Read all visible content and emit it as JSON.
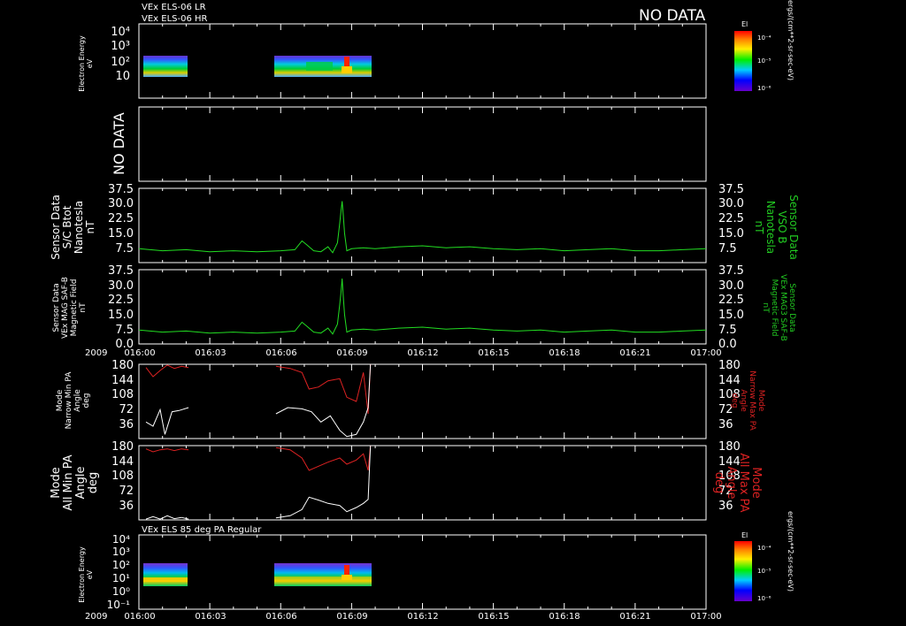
{
  "header": {
    "line1": "VEx ELS-06 LR",
    "line2": "VEx ELS-06 HR",
    "no_data_banner": "NO DATA"
  },
  "time_axis": {
    "year": "2009",
    "ticks": [
      "016:00",
      "016:03",
      "016:06",
      "016:09",
      "016:12",
      "016:15",
      "016:18",
      "016:21",
      "017:00"
    ]
  },
  "colors": {
    "background": "#000000",
    "axes": "#ffffff",
    "green_trace": "#22dd22",
    "green_label": "#22cc22",
    "red_trace": "#dd2222",
    "white_trace": "#ffffff"
  },
  "chart_data": [
    {
      "type": "heatmap",
      "panel": "electron-spectrogram-top",
      "ylabel": [
        "Electron Energy",
        "eV"
      ],
      "yscale": "log",
      "yticks": [
        "10",
        "10²",
        "10³",
        "10⁴"
      ],
      "colorbar": {
        "title": "El",
        "scale": "log",
        "ticks": [
          "10⁻⁴",
          "10⁻⁵",
          "10⁻⁶"
        ],
        "unit": "ergs/(cm**2-sr-sec-eV)"
      },
      "coverage_minutes": [
        [
          0,
          2.0
        ],
        [
          5.8,
          9.8
        ]
      ],
      "spike_minute": 8.6
    },
    {
      "type": "line",
      "panel": "no-data-panel",
      "no_data_label": "NO DATA"
    },
    {
      "type": "line",
      "panel": "bmag-sc",
      "ylabel": [
        "Sensor Data",
        "S/C Btot",
        "Nanotesla",
        "nT"
      ],
      "ylabel_right": [
        "Sensor Data",
        "VSO B",
        "Nanotesla",
        "nT"
      ],
      "ylim": [
        0,
        37.5
      ],
      "yticks": [
        "7.5",
        "15.0",
        "22.5",
        "30.0",
        "37.5"
      ],
      "series": [
        {
          "x": [
            0,
            1,
            2,
            3,
            4,
            5,
            6,
            6.6,
            6.9,
            7.1,
            7.4,
            7.7,
            8.0,
            8.2,
            8.4,
            8.5,
            8.55,
            8.6,
            8.65,
            8.7,
            8.8,
            9.0,
            9.5,
            10,
            11,
            12,
            13,
            14,
            15,
            16,
            17,
            18,
            19,
            20,
            21,
            22,
            23,
            24
          ],
          "y": [
            7,
            6,
            6.5,
            5.5,
            6,
            5.5,
            6,
            6.5,
            11,
            9,
            6,
            5.5,
            8,
            5,
            10,
            20,
            26,
            31,
            24,
            15,
            6,
            7,
            7.5,
            7,
            8,
            8.5,
            7.5,
            8,
            7,
            6.5,
            7,
            6,
            6.5,
            7,
            6,
            6,
            6.5,
            7
          ]
        }
      ]
    },
    {
      "type": "line",
      "panel": "bmag-mag",
      "ylabel": [
        "Sensor Data",
        "VEx MAG SAF-B",
        "Magnetic Field",
        "nT"
      ],
      "ylabel_right": [
        "Sensor Data",
        "VEx MAG3 SAF-B",
        "Magnetic Field",
        "nT"
      ],
      "ylim": [
        0,
        37.5
      ],
      "yticks": [
        "0.0",
        "7.5",
        "15.0",
        "22.5",
        "30.0",
        "37.5"
      ],
      "series": [
        {
          "x": [
            0,
            1,
            2,
            3,
            4,
            5,
            6,
            6.6,
            6.9,
            7.1,
            7.4,
            7.7,
            8.0,
            8.2,
            8.4,
            8.5,
            8.55,
            8.6,
            8.65,
            8.7,
            8.8,
            9.0,
            9.5,
            10,
            11,
            12,
            13,
            14,
            15,
            16,
            17,
            18,
            19,
            20,
            21,
            22,
            23,
            24
          ],
          "y": [
            7,
            6,
            6.5,
            5.5,
            6,
            5.5,
            6,
            6.5,
            11,
            9,
            6,
            5.5,
            8,
            5,
            10,
            20,
            26,
            33,
            24,
            15,
            6,
            7,
            7.5,
            7,
            8,
            8.5,
            7.5,
            8,
            7,
            6.5,
            7,
            6,
            6.5,
            7,
            6,
            6,
            6.5,
            7
          ]
        }
      ]
    },
    {
      "type": "line",
      "panel": "pitch-angle-narrow",
      "ylabel": [
        "Mode",
        "Narrow Min PA",
        "Angle",
        "deg"
      ],
      "ylabel_right": [
        "Mode",
        "Narrow Max PA",
        "Angle",
        "deg"
      ],
      "ylim": [
        0,
        180
      ],
      "yticks": [
        "36",
        "72",
        "108",
        "144",
        "180"
      ],
      "series": [
        {
          "color": "red",
          "segments": [
            {
              "x": [
                0.3,
                0.6,
                0.9,
                1.2,
                1.5,
                1.8,
                2.1
              ],
              "y": [
                172,
                150,
                165,
                178,
                170,
                175,
                172
              ]
            },
            {
              "x": [
                5.8,
                6.4,
                6.9,
                7.2,
                7.6,
                8.0,
                8.5,
                8.8,
                9.2,
                9.5,
                9.7,
                9.8
              ],
              "y": [
                175,
                170,
                160,
                120,
                125,
                140,
                145,
                100,
                90,
                160,
                60,
                180
              ]
            }
          ]
        },
        {
          "color": "white",
          "segments": [
            {
              "x": [
                0.3,
                0.6,
                0.9,
                1.1,
                1.4,
                1.7,
                2.1
              ],
              "y": [
                40,
                30,
                70,
                10,
                65,
                68,
                75
              ]
            },
            {
              "x": [
                5.8,
                6.3,
                6.9,
                7.3,
                7.7,
                8.1,
                8.5,
                8.8,
                9.2,
                9.5,
                9.7,
                9.8
              ],
              "y": [
                60,
                75,
                72,
                65,
                40,
                55,
                20,
                5,
                10,
                40,
                75,
                180
              ]
            }
          ]
        }
      ]
    },
    {
      "type": "line",
      "panel": "pitch-angle-all",
      "ylabel": [
        "Mode",
        "All Min PA",
        "Angle",
        "deg"
      ],
      "ylabel_right": [
        "Mode",
        "All Max PA",
        "Angle",
        "deg"
      ],
      "ylim": [
        0,
        180
      ],
      "yticks": [
        "36",
        "72",
        "108",
        "144",
        "180"
      ],
      "series": [
        {
          "color": "red",
          "segments": [
            {
              "x": [
                0.3,
                0.6,
                0.9,
                1.2,
                1.5,
                1.8,
                2.1
              ],
              "y": [
                172,
                165,
                170,
                172,
                168,
                172,
                170
              ]
            },
            {
              "x": [
                5.8,
                6.4,
                6.9,
                7.2,
                7.6,
                8.0,
                8.5,
                8.8,
                9.2,
                9.5,
                9.7,
                9.8
              ],
              "y": [
                175,
                170,
                150,
                120,
                130,
                140,
                150,
                135,
                145,
                160,
                120,
                180
              ]
            }
          ]
        },
        {
          "color": "white",
          "segments": [
            {
              "x": [
                0.3,
                0.6,
                0.9,
                1.2,
                1.5,
                1.8,
                2.1
              ],
              "y": [
                2,
                8,
                2,
                10,
                3,
                6,
                2
              ]
            },
            {
              "x": [
                5.8,
                6.4,
                6.9,
                7.2,
                7.6,
                8.0,
                8.5,
                8.8,
                9.2,
                9.5,
                9.7,
                9.8
              ],
              "y": [
                5,
                10,
                25,
                55,
                48,
                40,
                35,
                20,
                30,
                40,
                50,
                180
              ]
            }
          ]
        }
      ]
    },
    {
      "type": "heatmap",
      "panel": "electron-spectrogram-bottom",
      "title": "VEx ELS 85 deg PA Regular",
      "ylabel": [
        "Electron Energy",
        "eV"
      ],
      "yscale": "log",
      "yticks": [
        "10⁻¹",
        "10⁰",
        "10¹",
        "10²",
        "10³",
        "10⁴"
      ],
      "colorbar": {
        "title": "El",
        "scale": "log",
        "ticks": [
          "10⁻⁴",
          "10⁻⁵",
          "10⁻⁶"
        ],
        "unit": "ergs/(cm**2-sr-sec-eV)"
      },
      "coverage_minutes": [
        [
          0,
          2.0
        ],
        [
          5.8,
          9.8
        ]
      ],
      "spike_minute": 8.6
    }
  ]
}
